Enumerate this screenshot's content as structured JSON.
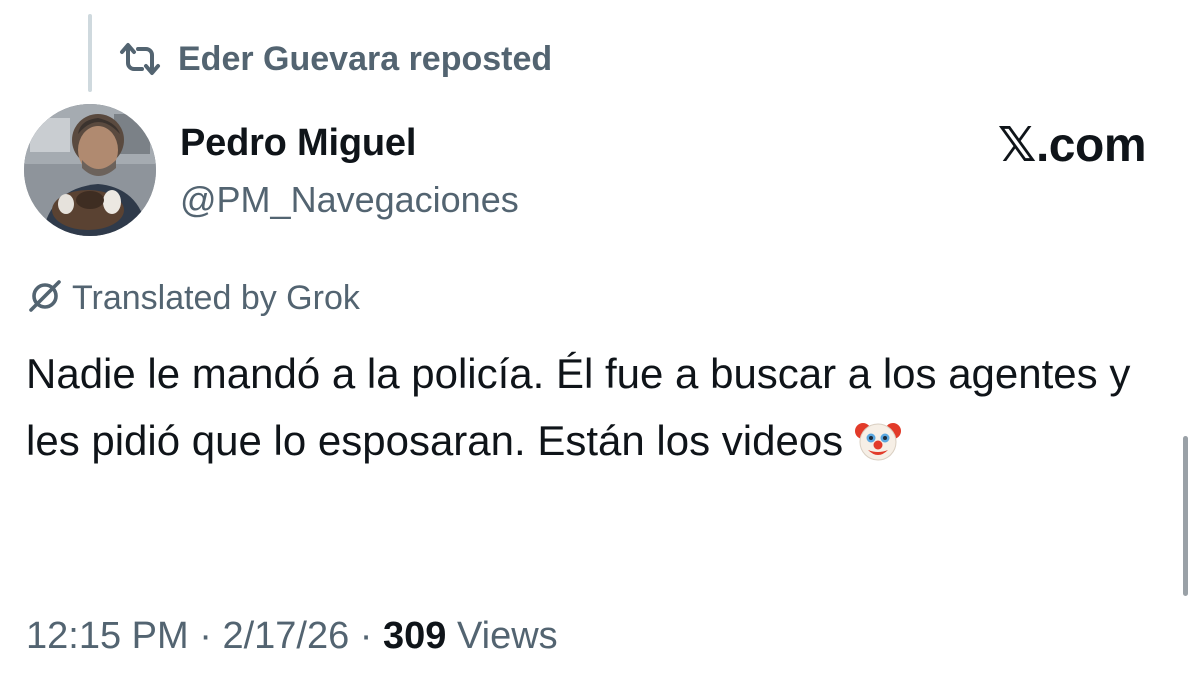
{
  "repost": {
    "icon": "repost-icon",
    "text": "Eder Guevara reposted"
  },
  "author": {
    "name": "Pedro Miguel",
    "handle": "@PM_Navegaciones",
    "avatar_icon": "profile-photo"
  },
  "site_label": "𝕏.com",
  "translation": {
    "icon": "grok-icon",
    "text": "Translated by Grok"
  },
  "post": {
    "text": "Nadie le mandó a la policía. Él fue a buscar a los agentes  y les pidió que lo esposaran. Están los videos",
    "emoji": "clown-face-emoji"
  },
  "meta": {
    "time": "12:15 PM",
    "separator": "·",
    "date": "2/17/26",
    "views_count": "309",
    "views_label": "Views"
  },
  "colors": {
    "primary_text": "#0f1419",
    "secondary_text": "#536471",
    "thread_line": "#cfd9de"
  }
}
